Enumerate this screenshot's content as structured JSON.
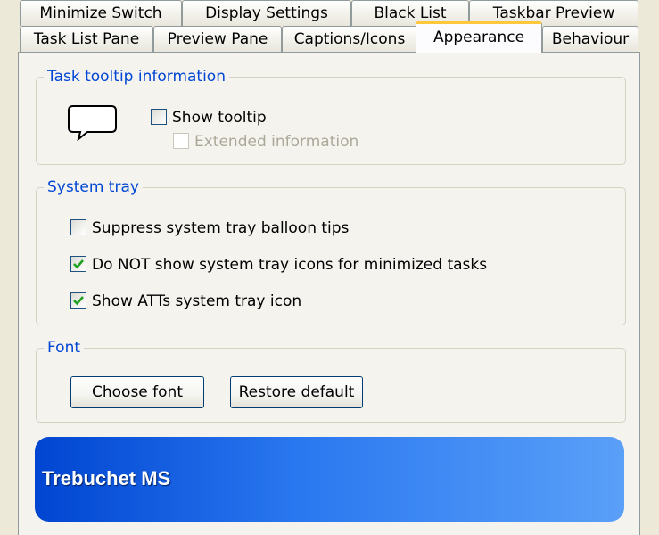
{
  "tabs": {
    "row_back": [
      "Minimize Switch",
      "Display Settings",
      "Black List",
      "Taskbar Preview"
    ],
    "row_front": [
      "Task List Pane",
      "Preview Pane",
      "Captions/Icons",
      "Appearance",
      "Behaviour"
    ],
    "active": "Appearance"
  },
  "task_tooltip": {
    "title": "Task tooltip information",
    "icon": "speech-bubble-icon",
    "show_tooltip": {
      "label": "Show tooltip",
      "checked": false
    },
    "extended_info": {
      "label": "Extended information",
      "checked": false,
      "enabled": false
    }
  },
  "system_tray": {
    "title": "System tray",
    "suppress_balloon": {
      "label": "Suppress system tray balloon tips",
      "checked": false
    },
    "no_minimized_icons": {
      "label": "Do NOT show system tray icons for minimized tasks",
      "checked": true
    },
    "show_atts_icon": {
      "label": "Show ATTs system tray icon",
      "checked": true
    }
  },
  "font": {
    "title": "Font",
    "choose_label": "Choose font",
    "restore_label": "Restore default",
    "preview_text": "Trebuchet MS"
  },
  "colors": {
    "group_title": "#0046d5",
    "active_tab_highlight": "#ffc83c",
    "check_mark": "#21a121"
  }
}
